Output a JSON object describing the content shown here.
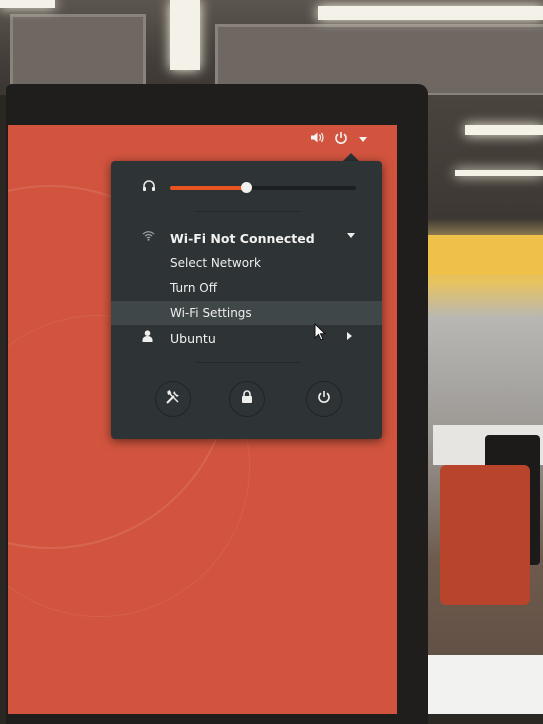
{
  "top_bar": {
    "volume_icon": "speaker-icon",
    "power_icon": "power-icon",
    "menu_arrow_icon": "chevron-down-icon"
  },
  "volume": {
    "icon": "headphones-icon",
    "level": 0.41,
    "accent_color": "#e95420"
  },
  "wifi": {
    "icon": "wifi-icon",
    "status_label": "Wi-Fi Not Connected",
    "items": [
      {
        "label": "Select Network"
      },
      {
        "label": "Turn Off"
      },
      {
        "label": "Wi-Fi Settings"
      }
    ],
    "hovered_item": "Wi-Fi Settings"
  },
  "user": {
    "icon": "user-icon",
    "name": "Ubuntu"
  },
  "actions": [
    {
      "name": "settings",
      "icon": "tools-icon"
    },
    {
      "name": "lock",
      "icon": "lock-icon"
    },
    {
      "name": "power-off",
      "icon": "power-icon"
    }
  ],
  "colors": {
    "desktop": "#d2543e",
    "menu_bg": "#2e3436",
    "text": "#eeeeec"
  }
}
